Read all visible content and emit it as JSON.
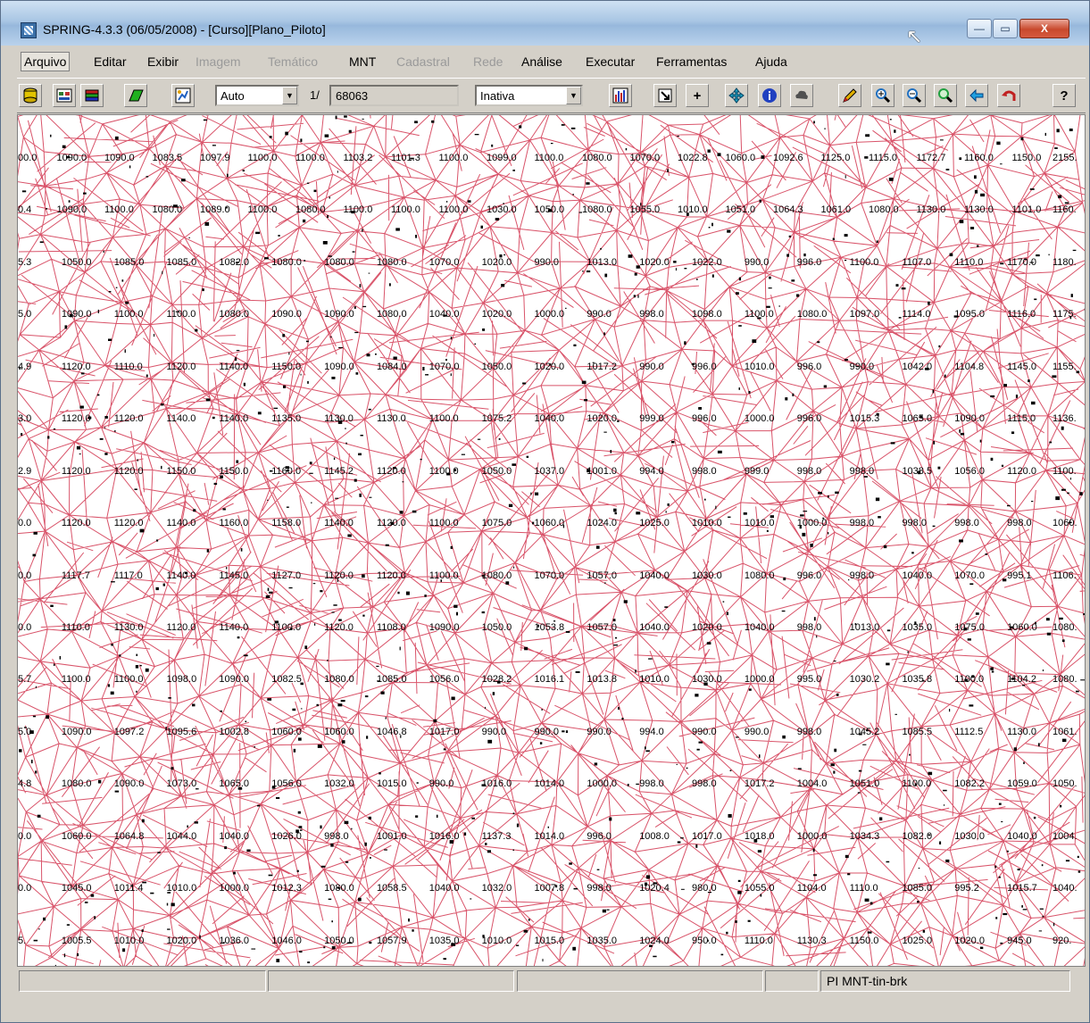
{
  "window": {
    "title": "SPRING-4.3.3 (06/05/2008) - [Curso][Plano_Piloto]",
    "controls": {
      "minimize": "—",
      "maximize": "▭",
      "close": "X"
    }
  },
  "menu": [
    {
      "label": "Arquivo",
      "state": "active"
    },
    {
      "label": "Editar",
      "state": "enabled"
    },
    {
      "label": "Exibir",
      "state": "enabled"
    },
    {
      "label": "Imagem",
      "state": "disabled"
    },
    {
      "label": "Temático",
      "state": "disabled"
    },
    {
      "label": "MNT",
      "state": "enabled"
    },
    {
      "label": "Cadastral",
      "state": "disabled"
    },
    {
      "label": "Rede",
      "state": "disabled"
    },
    {
      "label": "Análise",
      "state": "enabled"
    },
    {
      "label": "Executar",
      "state": "enabled"
    },
    {
      "label": "Ferramentas",
      "state": "enabled"
    },
    {
      "label": "Ajuda",
      "state": "enabled"
    }
  ],
  "toolbar": {
    "zoom_mode": "Auto",
    "scale_prefix": "1/",
    "scale_value": "68063",
    "mode_select": "Inativa",
    "icons": [
      "database-icon",
      "layers-icon",
      "stack-icon",
      "polygon-icon",
      "pan-icon",
      "histogram-icon",
      "fit-icon",
      "add-icon",
      "move-icon",
      "info-icon",
      "cloud-icon",
      "pencil-icon",
      "zoom-in-icon",
      "zoom-out-icon",
      "zoom-area-icon",
      "back-icon",
      "undo-icon",
      "help-icon"
    ]
  },
  "map": {
    "line_color": "#d9546a",
    "label_rows": [
      [
        "00.0",
        "1090.0",
        "1090.0",
        "1083.5",
        "1097.9",
        "1100.0",
        "1100.0",
        "1103.2",
        "1101.3",
        "1100.0",
        "1099.0",
        "1100.0",
        "1080.0",
        "1070.0",
        "1022.8",
        "1060.0",
        "1092.6",
        "1125.0",
        "1115.0",
        "1172.7",
        "1160.0",
        "1150.0",
        "2155."
      ],
      [
        "0.4",
        "1090.0",
        "1100.0",
        "1080.0",
        "1089.0",
        "1100.0",
        "1080.0",
        "1100.0",
        "1100.0",
        "1100.0",
        "1030.0",
        "1050.0",
        "1080.0",
        "1055.0",
        "1010.0",
        "1051.0",
        "1064.3",
        "1061.0",
        "1080.0",
        "1130.0",
        "1130.0",
        "1101.0",
        "1160."
      ],
      [
        "5.3",
        "1050.0",
        "1085.0",
        "1085.0",
        "1082.0",
        "1080.0",
        "1080.0",
        "1080.0",
        "1070.0",
        "1020.0",
        "990.0",
        "1013.0",
        "1020.0",
        "1022.0",
        "990.0",
        "996.0",
        "1100.0",
        "1107.0",
        "1110.0",
        "1170.0",
        "1180."
      ],
      [
        "5.0",
        "1090.0",
        "1100.0",
        "1100.0",
        "1080.0",
        "1090.0",
        "1090.0",
        "1080.0",
        "1040.0",
        "1020.0",
        "1000.0",
        "990.0",
        "998.0",
        "1098.0",
        "1100.0",
        "1080.0",
        "1097.0",
        "1114.0",
        "1095.0",
        "1116.0",
        "1175."
      ],
      [
        "4.9",
        "1120.0",
        "1110.0",
        "1120.0",
        "1140.0",
        "1150.0",
        "1090.0",
        "1084.0",
        "1070.0",
        "1050.0",
        "1020.0",
        "1017.2",
        "990.0",
        "996.0",
        "1010.0",
        "996.0",
        "990.0",
        "1042.0",
        "1104.8",
        "1145.0",
        "1155."
      ],
      [
        "3.0",
        "1120.0",
        "1120.0",
        "1140.0",
        "1140.0",
        "1135.0",
        "1130.0",
        "1130.0",
        "1100.0",
        "1075.2",
        "1040.0",
        "1020.0",
        "999.0",
        "996.0",
        "1000.0",
        "996.0",
        "1015.3",
        "1065.0",
        "1090.0",
        "1115.0",
        "1136."
      ],
      [
        "2.9",
        "1120.0",
        "1120.0",
        "1150.0",
        "1150.0",
        "1160.0",
        "1145.2",
        "1120.0",
        "1100.0",
        "1050.0",
        "1037.0",
        "1001.0",
        "994.0",
        "998.0",
        "999.0",
        "998.0",
        "998.0",
        "1038.5",
        "1056.0",
        "1120.0",
        "1100."
      ],
      [
        "0.0",
        "1120.0",
        "1120.0",
        "1140.0",
        "1160.0",
        "1158.0",
        "1140.0",
        "1120.0",
        "1100.0",
        "1075.0",
        "1060.0",
        "1024.0",
        "1025.0",
        "1010.0",
        "1010.0",
        "1000.0",
        "998.0",
        "998.0",
        "998.0",
        "998.0",
        "1060."
      ],
      [
        "0.0",
        "1117.7",
        "1117.0",
        "1140.0",
        "1145.0",
        "1127.0",
        "1120.0",
        "1120.0",
        "1100.0",
        "1080.0",
        "1070.0",
        "1057.0",
        "1040.0",
        "1030.0",
        "1080.0",
        "996.0",
        "998.0",
        "1040.0",
        "1070.0",
        "995.1",
        "1106."
      ],
      [
        "0.0",
        "1110.0",
        "1130.0",
        "1120.0",
        "1140.0",
        "1100.0",
        "1120.0",
        "1108.0",
        "1090.0",
        "1050.0",
        "1053.8",
        "1057.0",
        "1040.0",
        "1020.0",
        "1040.0",
        "998.0",
        "1013.0",
        "1035.0",
        "1075.0",
        "1060.0",
        "1080."
      ],
      [
        "5.7",
        "1100.0",
        "1100.0",
        "1098.0",
        "1090.0",
        "1082.5",
        "1080.0",
        "1085.0",
        "1056.0",
        "1028.2",
        "1016.1",
        "1013.8",
        "1010.0",
        "1030.0",
        "1000.0",
        "995.0",
        "1030.2",
        "1035.8",
        "1100.0",
        "1104.2",
        "1080."
      ],
      [
        "5.0",
        "1090.0",
        "1097.2",
        "1095.6",
        "1002.8",
        "1060.0",
        "1060.0",
        "1046.8",
        "1017.0",
        "990.0",
        "990.0",
        "990.0",
        "994.0",
        "990.0",
        "990.0",
        "998.0",
        "1045.2",
        "1085.5",
        "1112.5",
        "1130.0",
        "1061."
      ],
      [
        "4.8",
        "1080.0",
        "1090.0",
        "1073.0",
        "1065.0",
        "1056.0",
        "1032.0",
        "1015.0",
        "990.0",
        "1016.0",
        "1014.0",
        "1000.0",
        "998.0",
        "998.0",
        "1017.2",
        "1004.0",
        "1051.0",
        "1100.0",
        "1082.2",
        "1059.0",
        "1050."
      ],
      [
        "0.0",
        "1060.0",
        "1064.8",
        "1044.0",
        "1040.0",
        "1026.0",
        "998.0",
        "1001.0",
        "1016.0",
        "1137.3",
        "1014.0",
        "996.0",
        "1008.0",
        "1017.0",
        "1018.0",
        "1000.0",
        "1034.3",
        "1082.0",
        "1030.0",
        "1040.0",
        "1004."
      ],
      [
        "0.0",
        "1045.0",
        "1011.4",
        "1010.0",
        "1000.0",
        "1012.3",
        "1080.0",
        "1058.5",
        "1040.0",
        "1032.0",
        "1007.8",
        "998.0",
        "1020.4",
        "980.0",
        "1055.0",
        "1104.0",
        "1110.0",
        "1085.0",
        "995.2",
        "1015.7",
        "1040."
      ],
      [
        "5.",
        "1005.5",
        "1010.0",
        "1020.0",
        "1036.0",
        "1046.0",
        "1050.0",
        "1057.9",
        "1035.0",
        "1010.0",
        "1015.0",
        "1035.0",
        "1024.0",
        "950.0",
        "1110.0",
        "1130.3",
        "1150.0",
        "1025.0",
        "1020.0",
        "945.0",
        "920."
      ]
    ]
  },
  "status": {
    "panel1": "",
    "panel2": "",
    "panel3": "",
    "panel4": "",
    "panel5": "PI MNT-tin-brk"
  }
}
